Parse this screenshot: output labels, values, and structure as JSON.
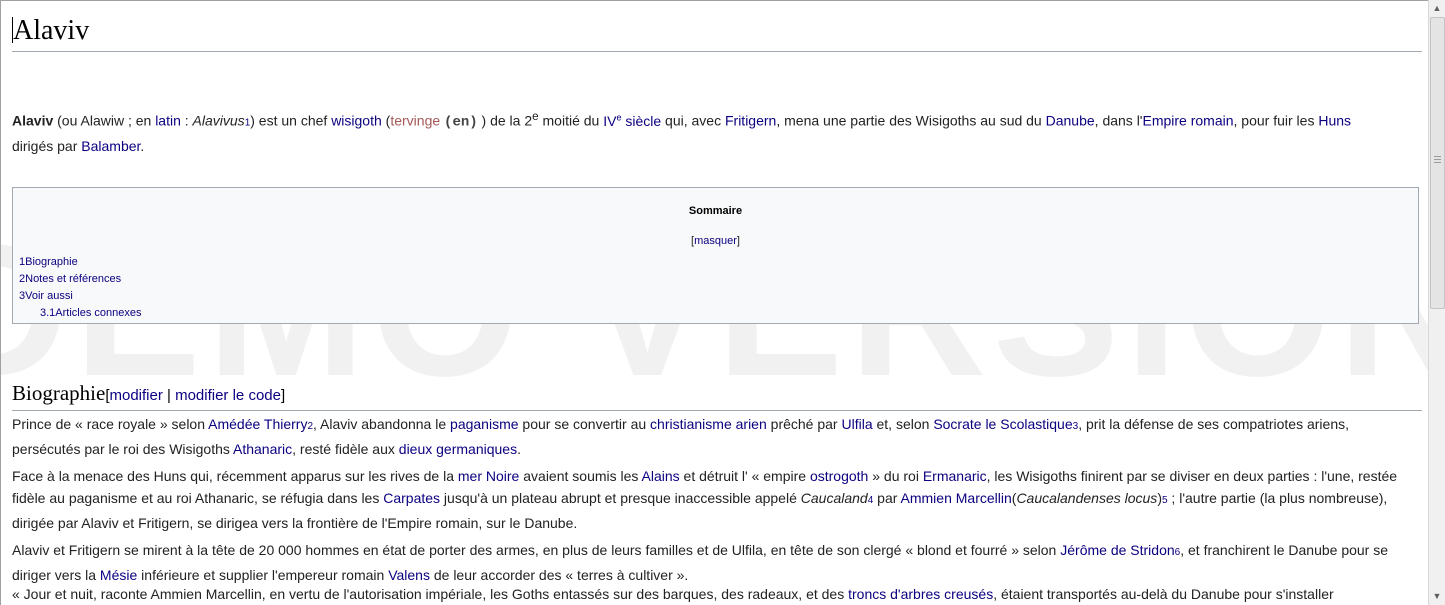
{
  "watermark": "DEMO VERSION",
  "page": {
    "title": "Alaviv"
  },
  "lead": {
    "subject": "Alaviv",
    "t1": " (ou Alawiw ; en ",
    "latin": "latin",
    "t2": " : ",
    "latin_name": "Alavivus",
    "ref1": "1",
    "t3": ") est un chef ",
    "wisigoth": "wisigoth",
    "t4": " (",
    "tervinge": "tervinge",
    "t5": " ",
    "en": "(en)",
    "t6": " ) de la 2",
    "sup_e": "e",
    "t7": " moitié du ",
    "iv": "IV",
    "iv_sup": "e",
    "siecle": " siècle",
    "t8": " qui, avec ",
    "fritigern": "Fritigern",
    "t9": ", mena une partie des Wisigoths au sud du ",
    "danube": "Danube",
    "t10": ", dans l'",
    "empire": "Empire romain",
    "t11": ", pour fuir les ",
    "huns": "Huns",
    "t12": " dirigés par ",
    "balamber": "Balamber",
    "t13": "."
  },
  "toc": {
    "title": "Sommaire",
    "hide_open": "[",
    "hide": "masquer",
    "hide_close": "]",
    "items": [
      {
        "num": "1",
        "label": "Biographie"
      },
      {
        "num": "2",
        "label": "Notes et références"
      },
      {
        "num": "3",
        "label": "Voir aussi"
      },
      {
        "num": "3.1",
        "label": "Articles connexes"
      }
    ]
  },
  "section": {
    "title": "Biographie",
    "edit_open": "[",
    "edit": "modifier",
    "sep": " | ",
    "edit_code": "modifier le code",
    "edit_close": "]"
  },
  "p1": {
    "t1": "Prince de « race royale » selon ",
    "thierry": "Amédée Thierry",
    "ref2": "2",
    "t2": ", Alaviv abandonna le ",
    "paganisme": "paganisme",
    "t3": " pour se convertir au ",
    "christ": "christianisme arien",
    "t4": " prêché par ",
    "ulfila": "Ulfila",
    "t5": " et, selon ",
    "socrate": "Socrate le Scolastique",
    "ref3": "3",
    "t6": ", prit la défense de ses compatriotes ariens, persécutés par le roi des Wisigoths ",
    "athanaric": "Athanaric",
    "t7": ", resté fidèle aux ",
    "dieux": "dieux germaniques",
    "t8": "."
  },
  "p2": {
    "t1": "Face à la menace des Huns qui, récemment apparus sur les rives de la ",
    "mer": "mer Noire",
    "t2": " avaient soumis les ",
    "alains": "Alains",
    "t3": " et détruit l' « empire ",
    "ostrogoth": "ostrogoth",
    "t4": " » du roi ",
    "ermanaric": "Ermanaric",
    "t5": ", les Wisigoths finirent par se diviser en deux parties : l'une, restée fidèle au paganisme et au roi Athanaric, se réfugia dans les ",
    "carpates": "Carpates",
    "t6": " jusqu'à un plateau abrupt et presque inaccessible appelé ",
    "caucaland": "Caucaland",
    "ref4": "4",
    "t7": " par ",
    "ammien": "Ammien Marcellin",
    "t8": "(",
    "caucalandenses": "Caucalandenses locus",
    "t9": ")",
    "ref5": "5",
    "t10": " ; l'autre partie (la plus nombreuse), dirigée par Alaviv et Fritigern, se dirigea vers la frontière de l'Empire romain, sur le Danube."
  },
  "p3": {
    "t1": "Alaviv et Fritigern se mirent à la tête de 20 000 hommes en état de porter des armes, en plus de leurs familles et de Ulfila, en tête de son clergé « blond et fourré » selon ",
    "jerome": "Jérôme de Stridon",
    "ref6": "6",
    "t2": ", et franchirent le Danube pour se diriger vers la ",
    "mesie": "Mésie",
    "t3": " inférieure et supplier l'empereur romain ",
    "valens": "Valens",
    "t4": " de leur accorder des « terres à cultiver »."
  },
  "p4": {
    "t1": "« Jour et nuit, raconte Ammien Marcellin, en vertu de l'autorisation impériale, les Goths entassés sur des barques, des radeaux, et des ",
    "troncs": "troncs d'arbres creusés",
    "t2": ", étaient transportés au-delà du Danube pour s'installer"
  }
}
